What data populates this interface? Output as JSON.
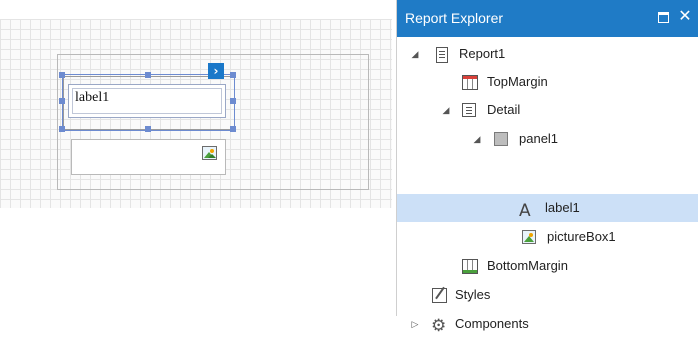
{
  "designer": {
    "label_text": "label1"
  },
  "explorer": {
    "title": "Report Explorer",
    "maximize_icon": "maximize-icon",
    "close_glyph": "✕",
    "nodes": [
      {
        "label": "Report1",
        "icon": "report-icon",
        "expander": "◢"
      },
      {
        "label": "TopMargin",
        "icon": "top-margin-icon"
      },
      {
        "label": "Detail",
        "icon": "detail-band-icon",
        "expander": "◢"
      },
      {
        "label": "panel1",
        "icon": "panel-icon",
        "expander": "◢"
      },
      {
        "label": "label1",
        "icon": "label-icon",
        "selected": true
      },
      {
        "label": "pictureBox1",
        "icon": "picture-box-icon"
      },
      {
        "label": "BottomMargin",
        "icon": "bottom-margin-icon"
      },
      {
        "label": "Styles",
        "icon": "styles-icon"
      },
      {
        "label": "Components",
        "icon": "gear-icon",
        "expander": "▷"
      }
    ]
  },
  "colors": {
    "titlebar": "#1f7bc6",
    "selection": "#cce0f7",
    "handle": "#6d8bd0"
  }
}
